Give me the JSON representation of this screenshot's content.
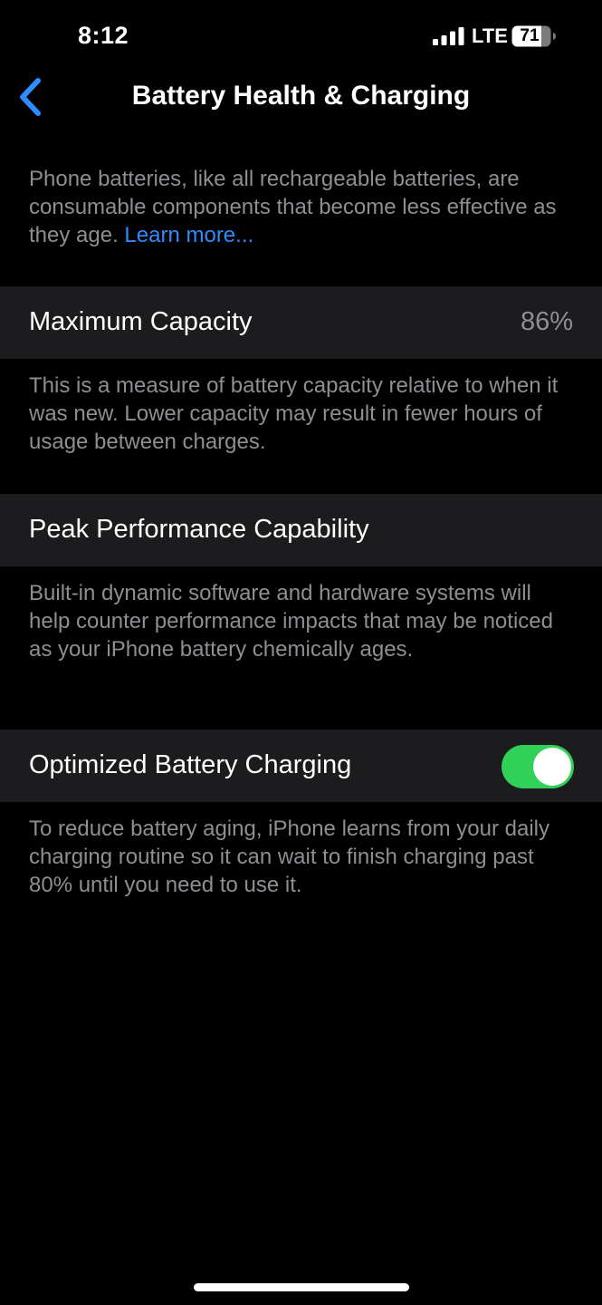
{
  "status_bar": {
    "time": "8:12",
    "network": "LTE",
    "battery_level": "71"
  },
  "nav": {
    "back_icon": "chevron-left-icon",
    "title": "Battery Health & Charging",
    "accent_color": "#2f8cff"
  },
  "intro": {
    "text": "Phone batteries, like all rechargeable batteries, are consumable components that become less effective as they age. ",
    "link_label": "Learn more..."
  },
  "maximum_capacity": {
    "label": "Maximum Capacity",
    "value": "86%",
    "description": "This is a measure of battery capacity relative to when it was new. Lower capacity may result in fewer hours of usage between charges."
  },
  "peak_performance": {
    "label": "Peak Performance Capability",
    "description": "Built-in dynamic software and hardware systems will help counter performance impacts that may be noticed as your iPhone battery chemically ages."
  },
  "optimized_charging": {
    "label": "Optimized Battery Charging",
    "enabled": true,
    "toggle_color": "#30d158",
    "description": "To reduce battery aging, iPhone learns from your daily charging routine so it can wait to finish charging past 80% until you need to use it."
  }
}
